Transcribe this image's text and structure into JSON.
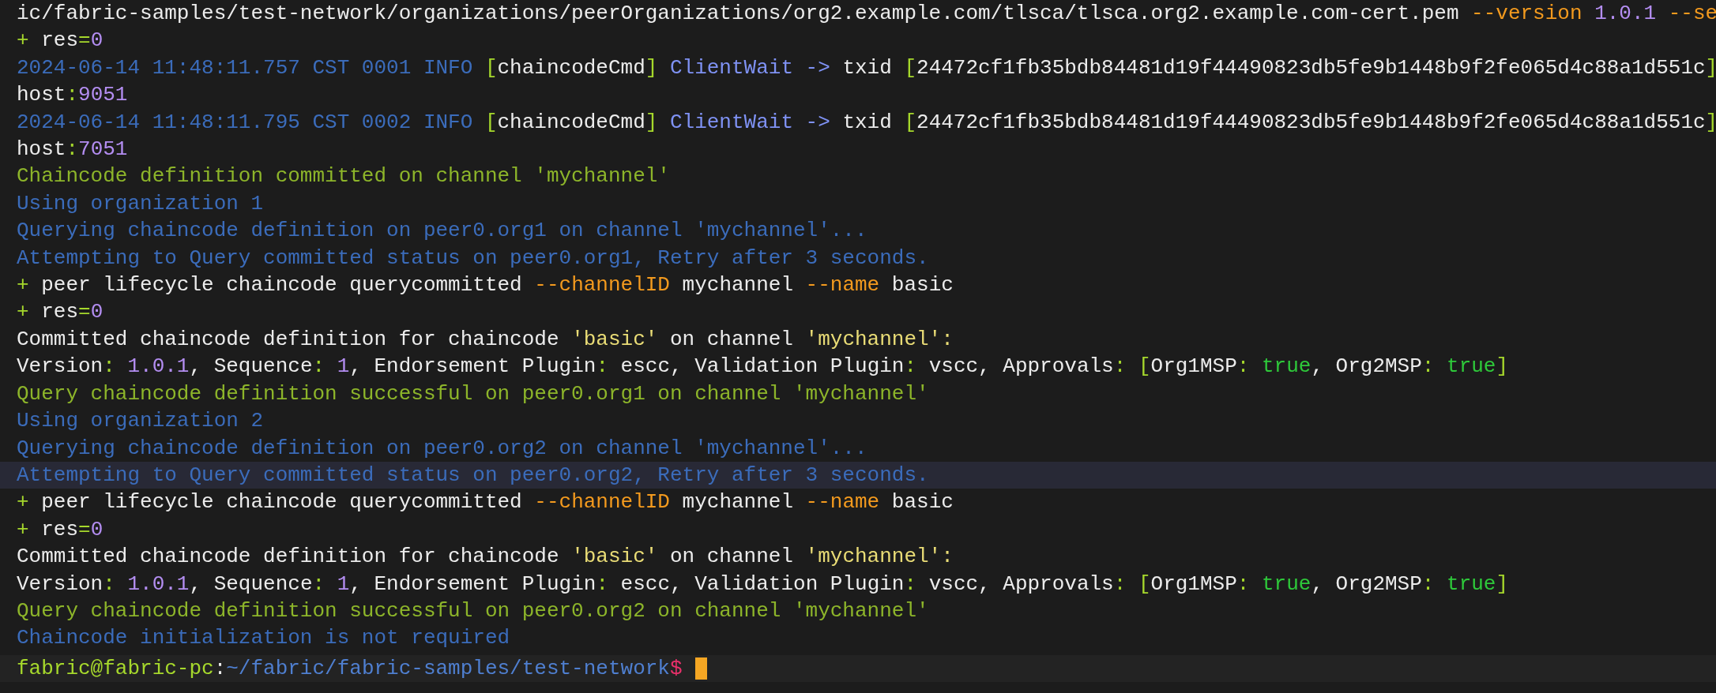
{
  "lines": [
    {
      "highlighted": false,
      "segments": [
        {
          "kind": "text",
          "text": "ic/fabric-samples/test-network/organizations/peerOrganizations/org2.example.com/tlsca/tlsca.org2.example.com-cert.pem "
        },
        {
          "kind": "flag",
          "text": "--version"
        },
        {
          "kind": "number",
          "text": " 1.0.1 "
        },
        {
          "kind": "flag",
          "text": "--se"
        }
      ]
    },
    {
      "highlighted": false,
      "segments": [
        {
          "kind": "operator",
          "text": "+ "
        },
        {
          "kind": "text",
          "text": "res"
        },
        {
          "kind": "operator",
          "text": "="
        },
        {
          "kind": "number",
          "text": "0"
        }
      ]
    },
    {
      "highlighted": false,
      "segments": [
        {
          "kind": "info",
          "text": "2024-06-14 11:48:11.757 CST 0001 INFO "
        },
        {
          "kind": "bracket",
          "text": "["
        },
        {
          "kind": "text",
          "text": "chaincodeCmd"
        },
        {
          "kind": "bracket",
          "text": "]"
        },
        {
          "kind": "keyword",
          "text": " ClientWait -> "
        },
        {
          "kind": "text",
          "text": "txid "
        },
        {
          "kind": "bracket",
          "text": "["
        },
        {
          "kind": "text",
          "text": "24472cf1fb35bdb84481d19f44490823db5fe9b1448b9f2fe065d4c88a1d551c"
        },
        {
          "kind": "bracket",
          "text": "]"
        }
      ]
    },
    {
      "highlighted": false,
      "segments": [
        {
          "kind": "text",
          "text": "host"
        },
        {
          "kind": "operator",
          "text": ":"
        },
        {
          "kind": "number",
          "text": "9051"
        }
      ]
    },
    {
      "highlighted": false,
      "segments": [
        {
          "kind": "info",
          "text": "2024-06-14 11:48:11.795 CST 0002 INFO "
        },
        {
          "kind": "bracket",
          "text": "["
        },
        {
          "kind": "text",
          "text": "chaincodeCmd"
        },
        {
          "kind": "bracket",
          "text": "]"
        },
        {
          "kind": "keyword",
          "text": " ClientWait -> "
        },
        {
          "kind": "text",
          "text": "txid "
        },
        {
          "kind": "bracket",
          "text": "["
        },
        {
          "kind": "text",
          "text": "24472cf1fb35bdb84481d19f44490823db5fe9b1448b9f2fe065d4c88a1d551c"
        },
        {
          "kind": "bracket",
          "text": "]"
        }
      ]
    },
    {
      "highlighted": false,
      "segments": [
        {
          "kind": "text",
          "text": "host"
        },
        {
          "kind": "operator",
          "text": ":"
        },
        {
          "kind": "number",
          "text": "7051"
        }
      ]
    },
    {
      "highlighted": false,
      "segments": [
        {
          "kind": "success",
          "text": "Chaincode definition committed on channel 'mychannel'"
        }
      ]
    },
    {
      "highlighted": false,
      "segments": [
        {
          "kind": "info",
          "text": "Using organization 1"
        }
      ]
    },
    {
      "highlighted": false,
      "segments": [
        {
          "kind": "info",
          "text": "Querying chaincode definition on peer0.org1 on channel 'mychannel'..."
        }
      ]
    },
    {
      "highlighted": false,
      "segments": [
        {
          "kind": "info",
          "text": "Attempting to Query committed status on peer0.org1, Retry after 3 seconds."
        }
      ]
    },
    {
      "highlighted": false,
      "segments": [
        {
          "kind": "operator",
          "text": "+ "
        },
        {
          "kind": "text",
          "text": "peer lifecycle chaincode querycommitted "
        },
        {
          "kind": "flag",
          "text": "--channelID"
        },
        {
          "kind": "text",
          "text": " mychannel "
        },
        {
          "kind": "flag",
          "text": "--name"
        },
        {
          "kind": "text",
          "text": " basic"
        }
      ]
    },
    {
      "highlighted": false,
      "segments": [
        {
          "kind": "operator",
          "text": "+ "
        },
        {
          "kind": "text",
          "text": "res"
        },
        {
          "kind": "operator",
          "text": "="
        },
        {
          "kind": "number",
          "text": "0"
        }
      ]
    },
    {
      "highlighted": false,
      "segments": [
        {
          "kind": "text",
          "text": "Committed chaincode definition for chaincode "
        },
        {
          "kind": "string",
          "text": "'basic'"
        },
        {
          "kind": "text",
          "text": " on channel "
        },
        {
          "kind": "string",
          "text": "'mychannel':"
        }
      ]
    },
    {
      "highlighted": false,
      "segments": [
        {
          "kind": "text",
          "text": "Version"
        },
        {
          "kind": "operator",
          "text": ": "
        },
        {
          "kind": "number",
          "text": "1.0.1"
        },
        {
          "kind": "text",
          "text": ", Sequence"
        },
        {
          "kind": "operator",
          "text": ": "
        },
        {
          "kind": "number",
          "text": "1"
        },
        {
          "kind": "text",
          "text": ", Endorsement Plugin"
        },
        {
          "kind": "operator",
          "text": ": "
        },
        {
          "kind": "text",
          "text": "escc, Validation Plugin"
        },
        {
          "kind": "operator",
          "text": ": "
        },
        {
          "kind": "text",
          "text": "vscc, Approvals"
        },
        {
          "kind": "operator",
          "text": ": "
        },
        {
          "kind": "bracket",
          "text": "["
        },
        {
          "kind": "text",
          "text": "Org1MSP"
        },
        {
          "kind": "operator",
          "text": ": "
        },
        {
          "kind": "bool",
          "text": "true"
        },
        {
          "kind": "text",
          "text": ", Org2MSP"
        },
        {
          "kind": "operator",
          "text": ": "
        },
        {
          "kind": "bool",
          "text": "true"
        },
        {
          "kind": "bracket",
          "text": "]"
        }
      ]
    },
    {
      "highlighted": false,
      "segments": [
        {
          "kind": "success",
          "text": "Query chaincode definition successful on peer0.org1 on channel 'mychannel'"
        }
      ]
    },
    {
      "highlighted": false,
      "segments": [
        {
          "kind": "info",
          "text": "Using organization 2"
        }
      ]
    },
    {
      "highlighted": false,
      "segments": [
        {
          "kind": "info",
          "text": "Querying chaincode definition on peer0.org2 on channel 'mychannel'..."
        }
      ]
    },
    {
      "highlighted": true,
      "segments": [
        {
          "kind": "info",
          "text": "Attempting to Query committed status on peer0.org2, Retry after 3 seconds."
        }
      ]
    },
    {
      "highlighted": false,
      "segments": [
        {
          "kind": "operator",
          "text": "+ "
        },
        {
          "kind": "text",
          "text": "peer lifecycle chaincode querycommitted "
        },
        {
          "kind": "flag",
          "text": "--channelID"
        },
        {
          "kind": "text",
          "text": " mychannel "
        },
        {
          "kind": "flag",
          "text": "--name"
        },
        {
          "kind": "text",
          "text": " basic"
        }
      ]
    },
    {
      "highlighted": false,
      "segments": [
        {
          "kind": "operator",
          "text": "+ "
        },
        {
          "kind": "text",
          "text": "res"
        },
        {
          "kind": "operator",
          "text": "="
        },
        {
          "kind": "number",
          "text": "0"
        }
      ]
    },
    {
      "highlighted": false,
      "segments": [
        {
          "kind": "text",
          "text": "Committed chaincode definition for chaincode "
        },
        {
          "kind": "string",
          "text": "'basic'"
        },
        {
          "kind": "text",
          "text": " on channel "
        },
        {
          "kind": "string",
          "text": "'mychannel':"
        }
      ]
    },
    {
      "highlighted": false,
      "segments": [
        {
          "kind": "text",
          "text": "Version"
        },
        {
          "kind": "operator",
          "text": ": "
        },
        {
          "kind": "number",
          "text": "1.0.1"
        },
        {
          "kind": "text",
          "text": ", Sequence"
        },
        {
          "kind": "operator",
          "text": ": "
        },
        {
          "kind": "number",
          "text": "1"
        },
        {
          "kind": "text",
          "text": ", Endorsement Plugin"
        },
        {
          "kind": "operator",
          "text": ": "
        },
        {
          "kind": "text",
          "text": "escc, Validation Plugin"
        },
        {
          "kind": "operator",
          "text": ": "
        },
        {
          "kind": "text",
          "text": "vscc, Approvals"
        },
        {
          "kind": "operator",
          "text": ": "
        },
        {
          "kind": "bracket",
          "text": "["
        },
        {
          "kind": "text",
          "text": "Org1MSP"
        },
        {
          "kind": "operator",
          "text": ": "
        },
        {
          "kind": "bool",
          "text": "true"
        },
        {
          "kind": "text",
          "text": ", Org2MSP"
        },
        {
          "kind": "operator",
          "text": ": "
        },
        {
          "kind": "bool",
          "text": "true"
        },
        {
          "kind": "bracket",
          "text": "]"
        }
      ]
    },
    {
      "highlighted": false,
      "segments": [
        {
          "kind": "success",
          "text": "Query chaincode definition successful on peer0.org2 on channel 'mychannel'"
        }
      ]
    },
    {
      "highlighted": false,
      "segments": [
        {
          "kind": "info",
          "text": "Chaincode initialization is not required"
        }
      ]
    }
  ],
  "prompt": {
    "user_host": "fabric@fabric-pc",
    "separator": ":",
    "path": "~/fabric/fabric-samples/test-network",
    "sign": "$"
  }
}
